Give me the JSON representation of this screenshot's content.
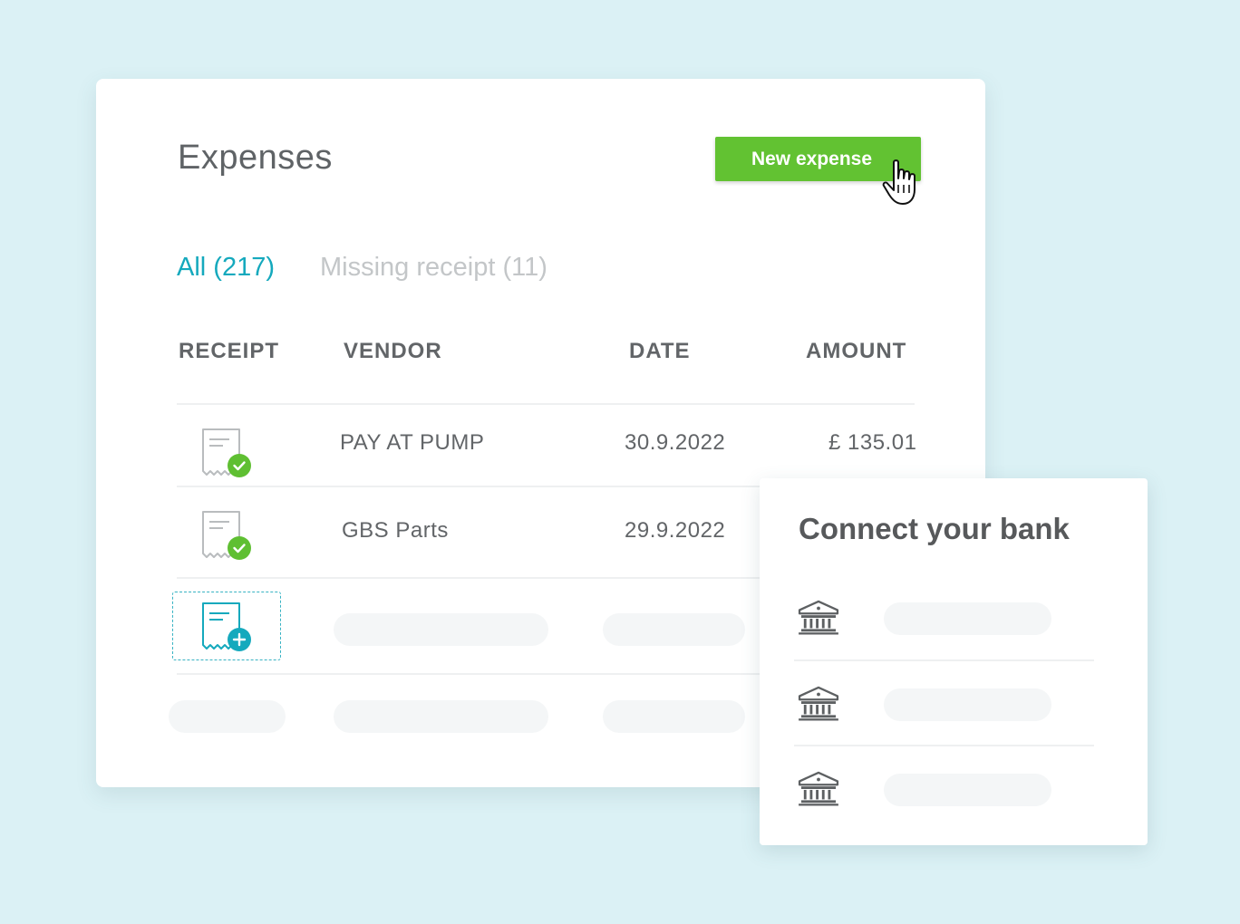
{
  "expenses": {
    "title": "Expenses",
    "new_button_label": "New expense",
    "tabs": [
      {
        "label": "All (217)",
        "active": true
      },
      {
        "label": "Missing receipt (11)",
        "active": false
      }
    ],
    "columns": [
      "RECEIPT",
      "VENDOR",
      "DATE",
      "AMOUNT"
    ],
    "rows": [
      {
        "receipt_status": "attached",
        "vendor": "PAY AT PUMP",
        "date": "30.9.2022",
        "amount": "£ 135.01"
      },
      {
        "receipt_status": "attached",
        "vendor": "GBS Parts",
        "date": "29.9.2022",
        "amount": ""
      },
      {
        "receipt_status": "add",
        "vendor": "",
        "date": "",
        "amount": ""
      },
      {
        "receipt_status": "none",
        "vendor": "",
        "date": "",
        "amount": ""
      }
    ]
  },
  "bank_panel": {
    "title": "Connect your bank",
    "banks": [
      {
        "icon": "bank-icon"
      },
      {
        "icon": "bank-icon"
      },
      {
        "icon": "bank-icon"
      }
    ]
  },
  "colors": {
    "background": "#dbf1f5",
    "accent": "#15a9bd",
    "button": "#62c232",
    "check": "#5fbf32",
    "text": "#626568",
    "placeholder": "#f4f6f7"
  }
}
